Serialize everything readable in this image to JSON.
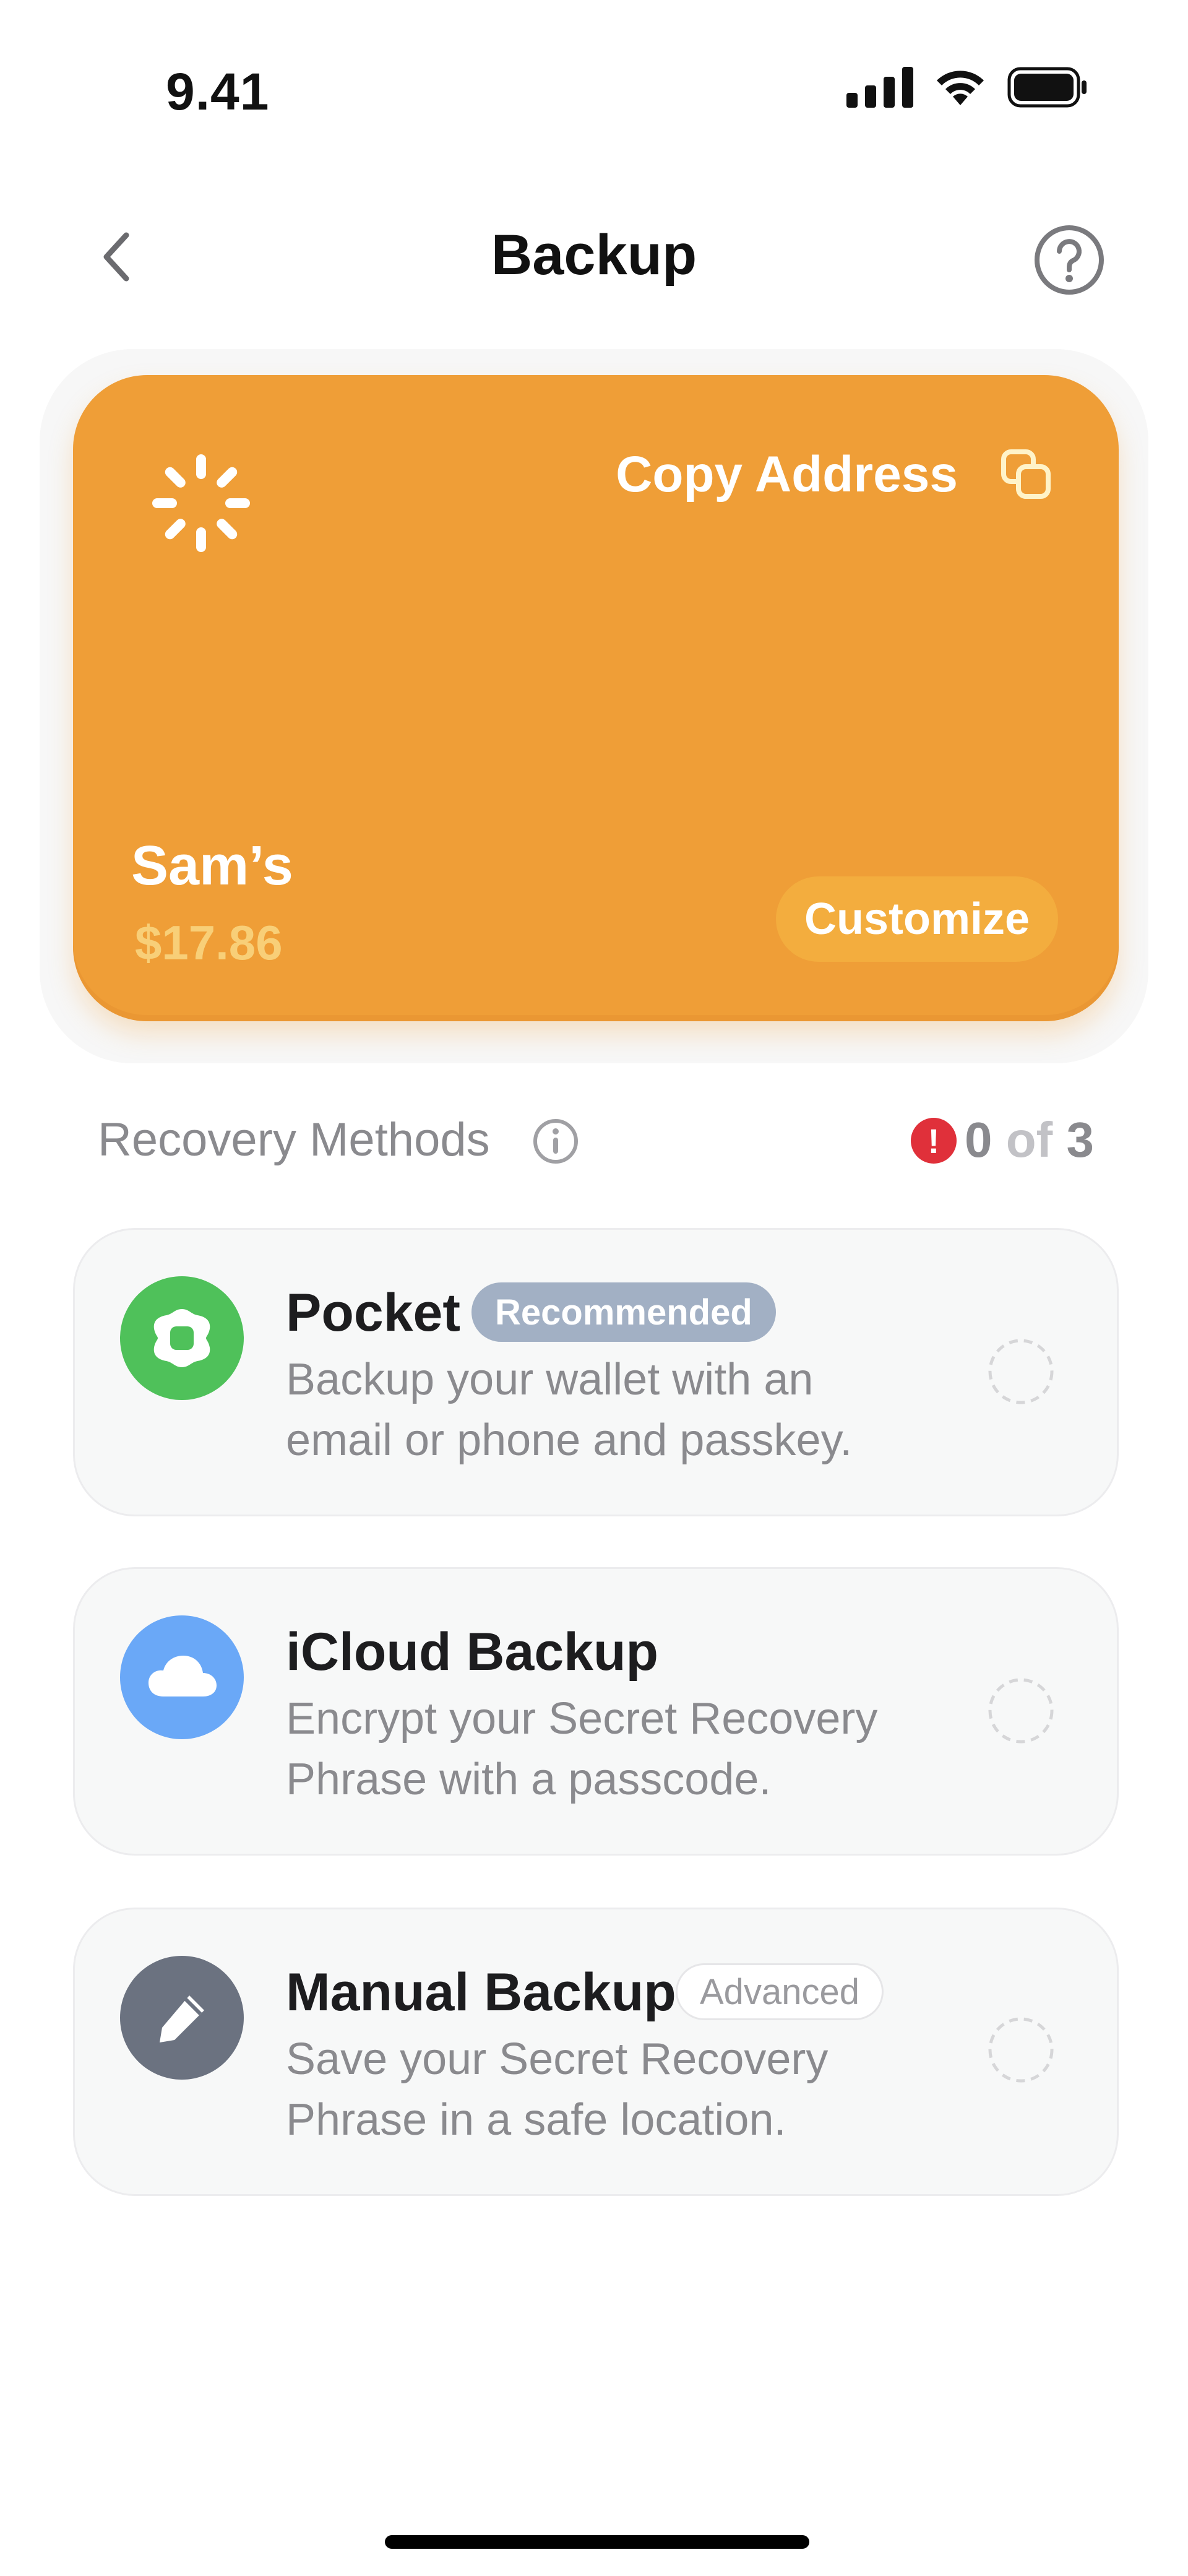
{
  "status_bar": {
    "time": "9.41",
    "icons": [
      "signal-icon",
      "wifi-icon",
      "battery-icon"
    ]
  },
  "header": {
    "title": "Backup",
    "back_icon": "chevron-left-icon",
    "help_icon": "question-circle-icon"
  },
  "wallet_card": {
    "color": "#ef9e37",
    "copy_address_label": "Copy Address",
    "copy_icon": "copy-icon",
    "spinner_icon": "loading-spinner-icon",
    "name": "Sam’s",
    "balance": "$17.86",
    "customize_label": "Customize"
  },
  "recovery": {
    "label": "Recovery Methods",
    "info_icon": "info-icon",
    "alert_glyph": "!",
    "count_done": "0",
    "count_of": "of",
    "count_total": "3"
  },
  "methods": [
    {
      "title": "Pocket",
      "badge": "Recommended",
      "desc_line1": "Backup your wallet with an",
      "desc_line2": "email or phone and passkey.",
      "icon": "pocket-shield-icon",
      "icon_color": "#4fc15a"
    },
    {
      "title": "iCloud Backup",
      "desc_line1": "Encrypt your Secret Recovery",
      "desc_line2": "Phrase with a passcode.",
      "icon": "cloud-icon",
      "icon_color": "#6aa8f7"
    },
    {
      "title": "Manual Backup",
      "badge": "Advanced",
      "desc_line1": "Save your Secret Recovery",
      "desc_line2": "Phrase in a safe location.",
      "icon": "pencil-icon",
      "icon_color": "#6b7280"
    }
  ]
}
